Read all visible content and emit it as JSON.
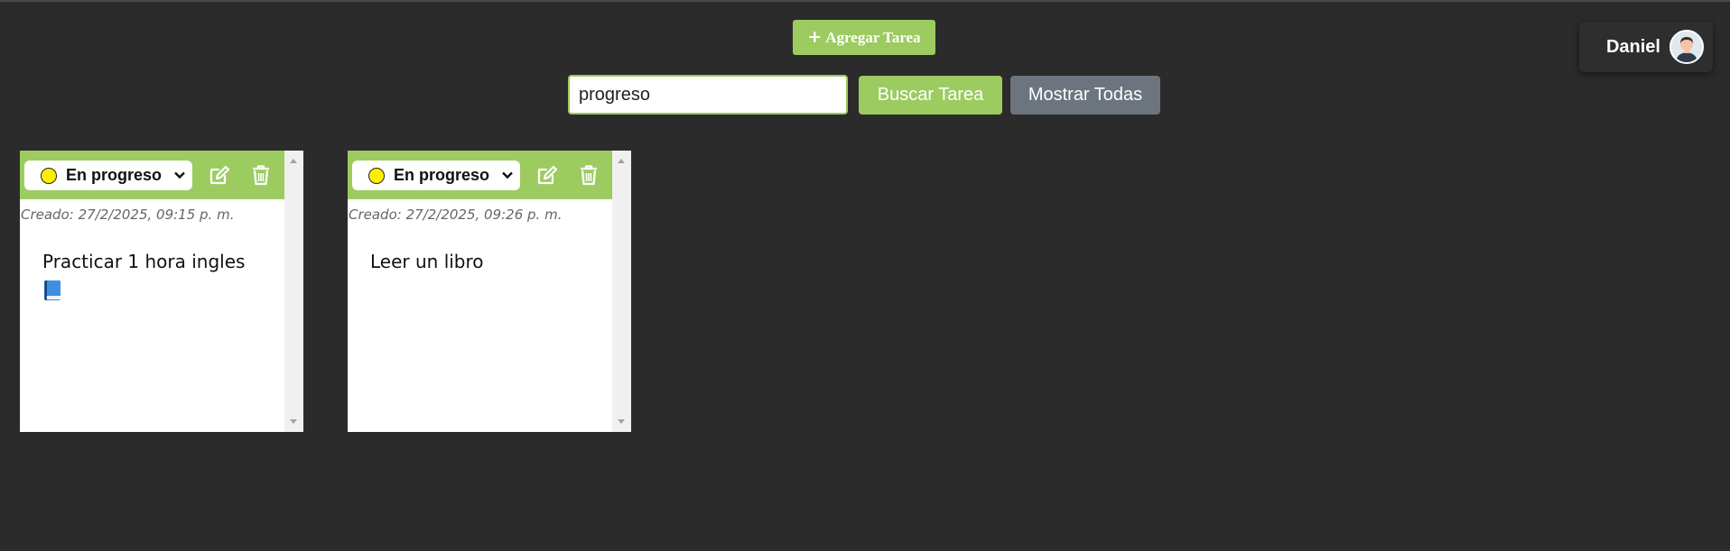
{
  "toolbar": {
    "add_label": "Agregar Tarea",
    "search_value": "progreso",
    "search_button": "Buscar Tarea",
    "show_all_button": "Mostrar Todas"
  },
  "user": {
    "name": "Daniel"
  },
  "colors": {
    "accent": "#9ccb5f",
    "secondary": "#6c757d",
    "background": "#2b2b2b",
    "status_dot": "#ffee00"
  },
  "tasks": [
    {
      "status": "En progreso",
      "created": "Creado: 27/2/2025, 09:15 p. m.",
      "text": "Practicar 1 hora ingles",
      "emoji_icon": "blue-book-icon"
    },
    {
      "status": "En progreso",
      "created": "Creado: 27/2/2025, 09:26 p. m.",
      "text": "Leer un libro"
    }
  ]
}
